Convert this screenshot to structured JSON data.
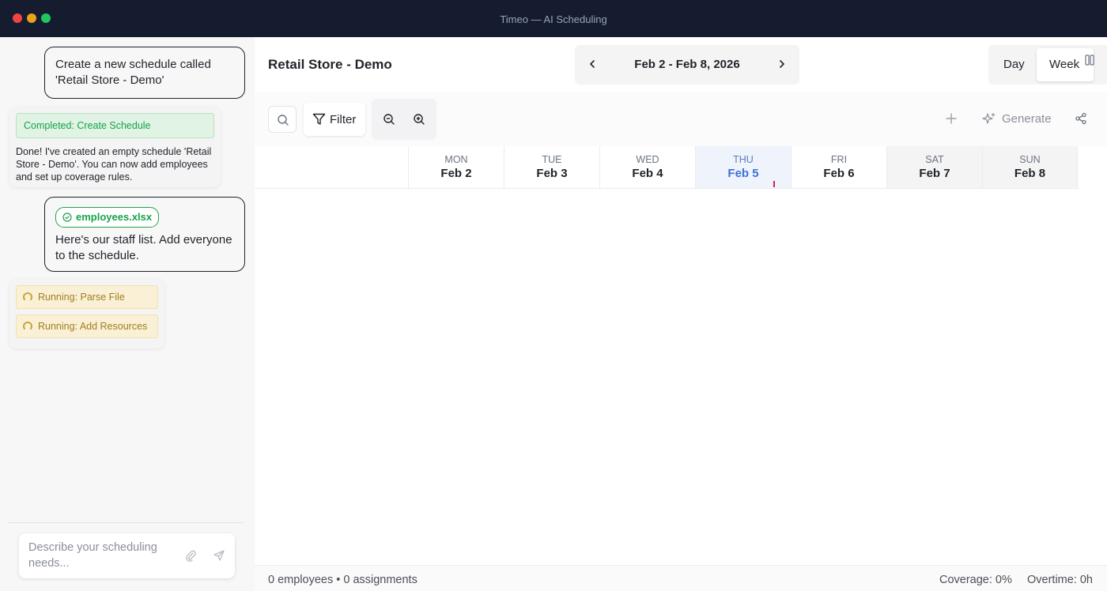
{
  "window": {
    "title": "Timeo — AI Scheduling"
  },
  "chat": {
    "messages": [
      {
        "role": "user",
        "text": "Create a new schedule called 'Retail Store - Demo'"
      },
      {
        "role": "assistant",
        "status": "Completed: Create Schedule",
        "text": "Done! I've created an empty schedule 'Retail Store - Demo'. You can now add employees and set up coverage rules."
      },
      {
        "role": "user",
        "attachment": "employees.xlsx",
        "text": "Here's our staff list. Add everyone to the schedule."
      },
      {
        "role": "assistant",
        "running": [
          "Running: Parse File",
          "Running: Add Resources"
        ]
      }
    ],
    "input": {
      "placeholder": "Describe your scheduling needs..."
    }
  },
  "header": {
    "title": "Retail Store - Demo",
    "date_range": "Feb 2 - Feb 8, 2026",
    "views": {
      "day": "Day",
      "week": "Week"
    }
  },
  "toolbar": {
    "filter_label": "Filter",
    "generate_label": "Generate"
  },
  "days": [
    {
      "dow": "MON",
      "date": "Feb 2",
      "state": "normal"
    },
    {
      "dow": "TUE",
      "date": "Feb 3",
      "state": "normal"
    },
    {
      "dow": "WED",
      "date": "Feb 4",
      "state": "normal"
    },
    {
      "dow": "THU",
      "date": "Feb 5",
      "state": "today"
    },
    {
      "dow": "FRI",
      "date": "Feb 6",
      "state": "normal"
    },
    {
      "dow": "SAT",
      "date": "Feb 7",
      "state": "weekend"
    },
    {
      "dow": "SUN",
      "date": "Feb 8",
      "state": "weekend"
    }
  ],
  "footer": {
    "counts": "0 employees • 0 assignments",
    "coverage": "Coverage: 0%",
    "overtime": "Overtime: 0h"
  },
  "colors": {
    "titlebar": "#151c2f",
    "accent_today": "#3b73d6",
    "completed": "#16a34a",
    "running": "#a07e1e"
  }
}
